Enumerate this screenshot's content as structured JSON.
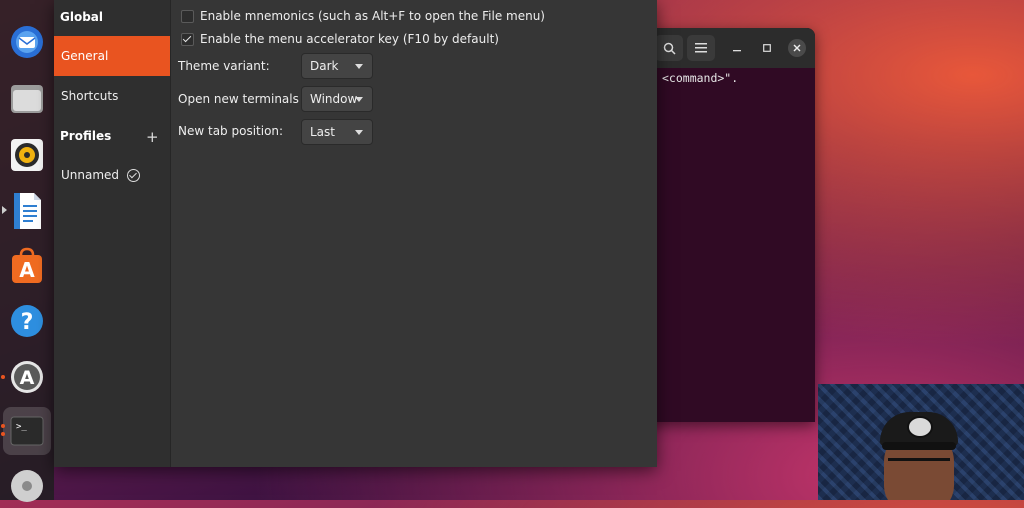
{
  "dock": {
    "items": [
      "email-app",
      "files-app",
      "music-player",
      "text-editor",
      "app-store",
      "help",
      "software-updater",
      "terminal",
      "dvd"
    ]
  },
  "terminal": {
    "output_text": "<command>\"."
  },
  "preferences": {
    "sidebar": {
      "global_heading": "Global",
      "general_label": "General",
      "shortcuts_label": "Shortcuts",
      "profiles_heading": "Profiles",
      "add_profile_symbol": "+",
      "profile_name": "Unnamed"
    },
    "general": {
      "mnemonics_label": "Enable mnemonics (such as Alt+F to open the File menu)",
      "mnemonics_checked": false,
      "accelerator_label": "Enable the menu accelerator key (F10 by default)",
      "accelerator_checked": true,
      "theme_variant_label": "Theme variant:",
      "theme_variant_value": "Dark",
      "new_terminals_label": "Open new terminals in:",
      "new_terminals_value": "Window",
      "new_tab_label": "New tab position:",
      "new_tab_value": "Last"
    }
  },
  "colors": {
    "accent": "#e95420",
    "window_bg": "#363636",
    "sidebar_bg": "#2f2f2f",
    "terminal_bg": "#300a24"
  }
}
